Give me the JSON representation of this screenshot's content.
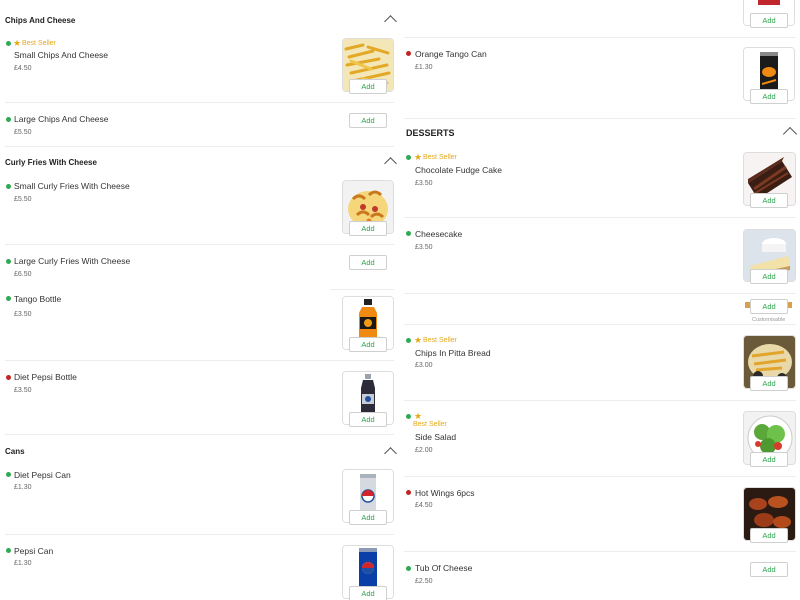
{
  "left": {
    "sections": [
      {
        "title": "Chips And Cheese"
      },
      {
        "title": "Curly Fries With Cheese"
      },
      {
        "title": "Cans"
      }
    ],
    "items": [
      {
        "name": "Small Chips And Cheese",
        "price": "£4.50",
        "best": "Best Seller",
        "add": "Add"
      },
      {
        "name": "Large Chips And Cheese",
        "price": "£5.50",
        "add": "Add"
      },
      {
        "name": "Small Curly Fries With Cheese",
        "price": "£5.50",
        "add": "Add"
      },
      {
        "name": "Large Curly Fries With Cheese",
        "price": "£6.50",
        "add": "Add"
      },
      {
        "name": "Tango Bottle",
        "price": "£3.50",
        "add": "Add"
      },
      {
        "name": "Diet Pepsi Bottle",
        "price": "£3.50",
        "add": "Add"
      },
      {
        "name": "Diet Pepsi Can",
        "price": "£1.30",
        "add": "Add"
      },
      {
        "name": "Pepsi Can",
        "price": "£1.30",
        "add": "Add"
      }
    ]
  },
  "right": {
    "sections": [
      {
        "title": "DESSERTS"
      }
    ],
    "items": [
      {
        "add": "Add"
      },
      {
        "name": "Orange Tango Can",
        "price": "£1.30",
        "add": "Add"
      },
      {
        "name": "Chocolate Fudge Cake",
        "price": "£3.50",
        "best": "Best Seller",
        "add": "Add"
      },
      {
        "name": "Cheesecake",
        "price": "£3.50",
        "add": "Add"
      },
      {
        "add": "Add",
        "note": "Customisable"
      },
      {
        "name": "Chips In Pitta Bread",
        "price": "£3.00",
        "best": "Best Seller",
        "add": "Add"
      },
      {
        "name": "Side Salad",
        "price": "£2.00",
        "best": "Best Seller",
        "add": "Add"
      },
      {
        "name": "Hot Wings 6pcs",
        "price": "£4.50",
        "add": "Add"
      },
      {
        "name": "Tub Of Cheese",
        "price": "£2.50",
        "add": "Add"
      }
    ]
  },
  "icons": {
    "star": "★",
    "chevron": "chevron-up-icon"
  },
  "colors": {
    "veg": "#2eaa52",
    "nonveg": "#c22525",
    "accent_add": "#2ea44f",
    "best_seller": "#e5a91a"
  }
}
